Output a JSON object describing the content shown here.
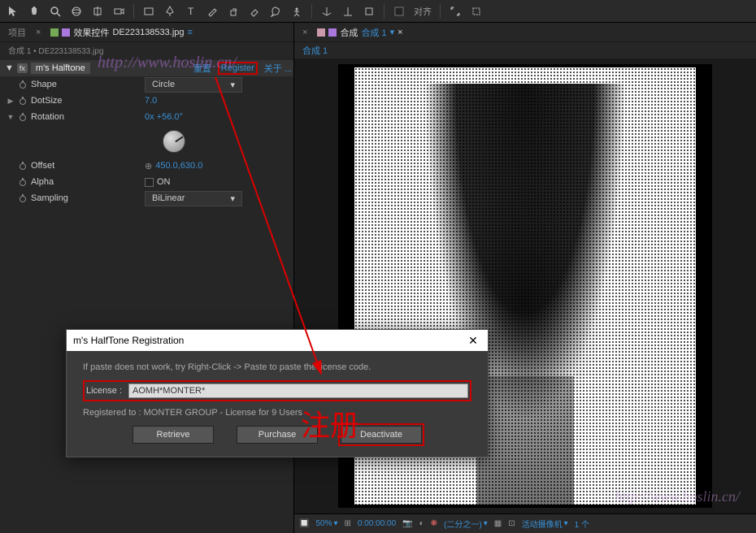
{
  "toolbar": {
    "snap_label": "对齐"
  },
  "left": {
    "tabs": {
      "project": "项目",
      "effects": "效果控件",
      "file": "DE223138533.jpg"
    },
    "breadcrumb": {
      "comp": "合成 1",
      "sep": "•",
      "file": "DE223138533.jpg"
    },
    "effect": {
      "name": "m's Halftone",
      "reset": "重置",
      "register": "Register",
      "about": "关于 ...",
      "props": {
        "shape": {
          "label": "Shape",
          "value": "Circle"
        },
        "dotsize": {
          "label": "DotSize",
          "value": "7.0"
        },
        "rotation": {
          "label": "Rotation",
          "value": "0x +56.0°"
        },
        "offset": {
          "label": "Offset",
          "value": "450.0,630.0"
        },
        "alpha": {
          "label": "Alpha",
          "value": "ON"
        },
        "sampling": {
          "label": "Sampling",
          "value": "BiLinear"
        }
      }
    }
  },
  "right": {
    "tabs": {
      "comp_label": "合成",
      "comp_name": "合成 1"
    },
    "breadcrumb": "合成 1",
    "footer": {
      "zoom": "50%",
      "time": "0:00:00:00",
      "resolution": "(二分之一)",
      "camera": "活动摄像机",
      "views": "1 个"
    }
  },
  "dialog": {
    "title": "m's HalfTone Registration",
    "hint": "If paste does not work, try Right-Click -> Paste to paste the license code.",
    "license_label": "License :",
    "license_value": "AOMH*MONTER*",
    "registered_to": "Registered to :   MONTER GROUP - License for 9 Users",
    "buttons": {
      "retrieve": "Retrieve",
      "purchase": "Purchase",
      "deactivate": "Deactivate"
    }
  },
  "watermark": "http://www.hoslin.cn/",
  "annotation": "注册"
}
